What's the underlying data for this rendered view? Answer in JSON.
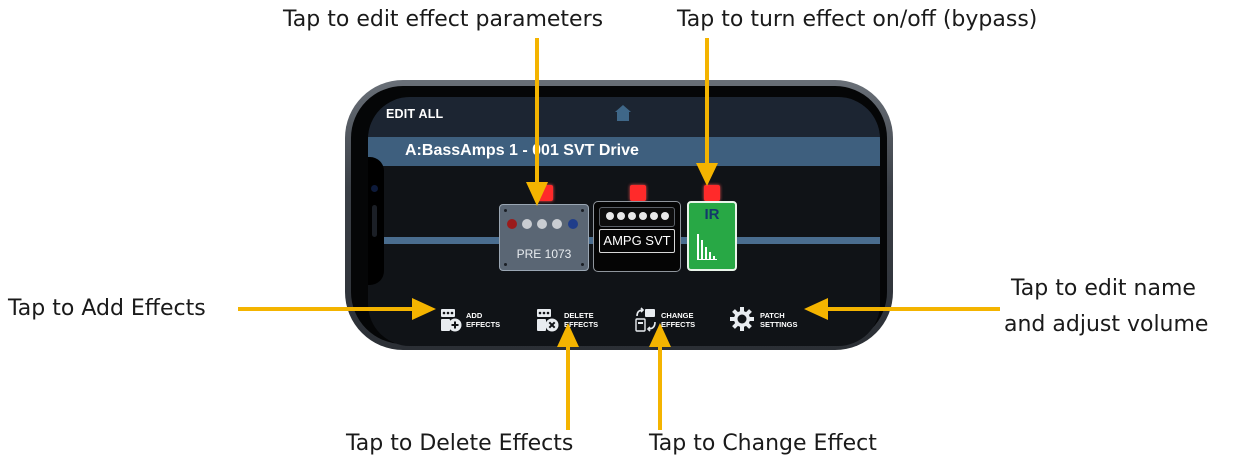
{
  "callouts": {
    "edit_params": "Tap to edit effect parameters",
    "bypass": "Tap to turn effect on/off (bypass)",
    "add": "Tap to Add Effects",
    "edit_name_1": "Tap to edit name",
    "edit_name_2": "and adjust volume",
    "delete": "Tap to Delete Effects",
    "change": "Tap to Change Effect"
  },
  "app": {
    "edit_all": "EDIT ALL",
    "home_icon": "home-icon",
    "patch_name": "A:BassAmps 1 - 001 SVT Drive"
  },
  "chain": [
    {
      "label": "PRE 1073",
      "icon": "preamp-pedal",
      "bypass_on": true
    },
    {
      "label": "AMPG SVT",
      "icon": "amp-head",
      "bypass_on": true
    },
    {
      "label": "IR",
      "icon": "impulse-response",
      "bypass_on": true
    }
  ],
  "toolbar": {
    "add_1": "ADD",
    "add_2": "EFFECTS",
    "delete_1": "DELETE",
    "delete_2": "EFFECTS",
    "change_1": "CHANGE",
    "change_2": "EFFECTS",
    "patch_1": "PATCH",
    "patch_2": "SETTINGS"
  },
  "colors": {
    "arrow": "#f4b400",
    "led": "#ff2a2a",
    "patch_bar": "#3e5f7e",
    "ir_block": "#28a845"
  }
}
